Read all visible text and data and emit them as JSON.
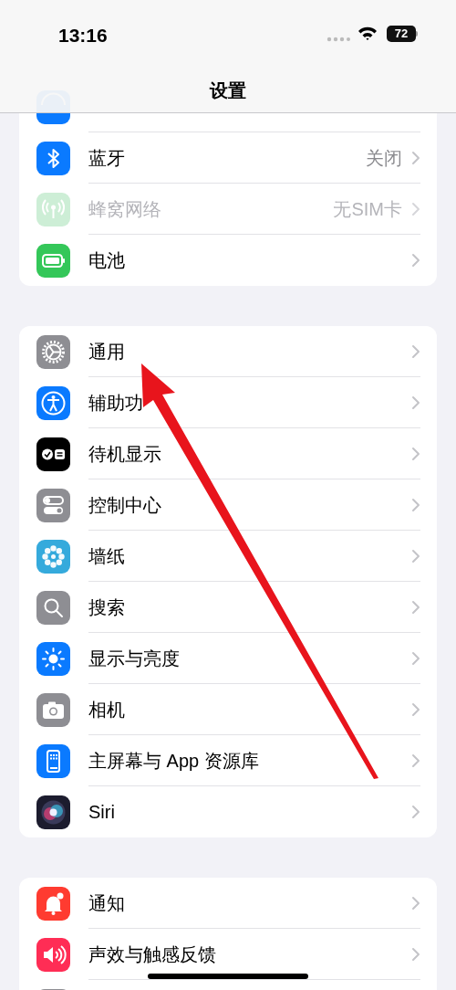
{
  "status_bar": {
    "time": "13:16",
    "battery": "72"
  },
  "nav": {
    "title": "设置"
  },
  "groups": [
    {
      "rows": [
        {
          "kind": "wifi",
          "color": "#0a7aff"
        },
        {
          "kind": "bluetooth",
          "color": "#0a7aff",
          "label": "蓝牙",
          "value": "关闭",
          "disabled": false
        },
        {
          "kind": "cellular",
          "color": "#cdeed6",
          "label": "蜂窝网络",
          "value": "无SIM卡",
          "disabled": true
        },
        {
          "kind": "battery",
          "color": "#34c759",
          "label": "电池",
          "disabled": false
        }
      ]
    },
    {
      "rows": [
        {
          "kind": "gear",
          "color": "#8e8e93",
          "label": "通用",
          "disabled": false
        },
        {
          "kind": "accessibility",
          "color": "#0a7aff",
          "label": "辅助功",
          "disabled": false
        },
        {
          "kind": "standby",
          "color": "#000000",
          "label": "待机显示",
          "disabled": false
        },
        {
          "kind": "toggles",
          "color": "#8e8e93",
          "label": "控制中心",
          "disabled": false
        },
        {
          "kind": "flower",
          "color": "#35aadc",
          "label": "墙纸",
          "disabled": false
        },
        {
          "kind": "search",
          "color": "#8e8e93",
          "label": "搜索",
          "disabled": false
        },
        {
          "kind": "sun",
          "color": "#0a7aff",
          "label": "显示与亮度",
          "disabled": false
        },
        {
          "kind": "camera",
          "color": "#8e8e93",
          "label": "相机",
          "disabled": false
        },
        {
          "kind": "phone",
          "color": "#0a7aff",
          "label": "主屏幕与 App 资源库",
          "disabled": false
        },
        {
          "kind": "siri",
          "color": "#1c1c2e",
          "label": "Siri",
          "disabled": false
        }
      ]
    },
    {
      "rows": [
        {
          "kind": "bell",
          "color": "#ff3b30",
          "label": "通知",
          "disabled": false
        },
        {
          "kind": "speaker",
          "color": "#ff2d55",
          "label": "声效与触感反馈",
          "disabled": false
        },
        {
          "kind": "blank",
          "color": "#8e8e93"
        }
      ]
    }
  ]
}
